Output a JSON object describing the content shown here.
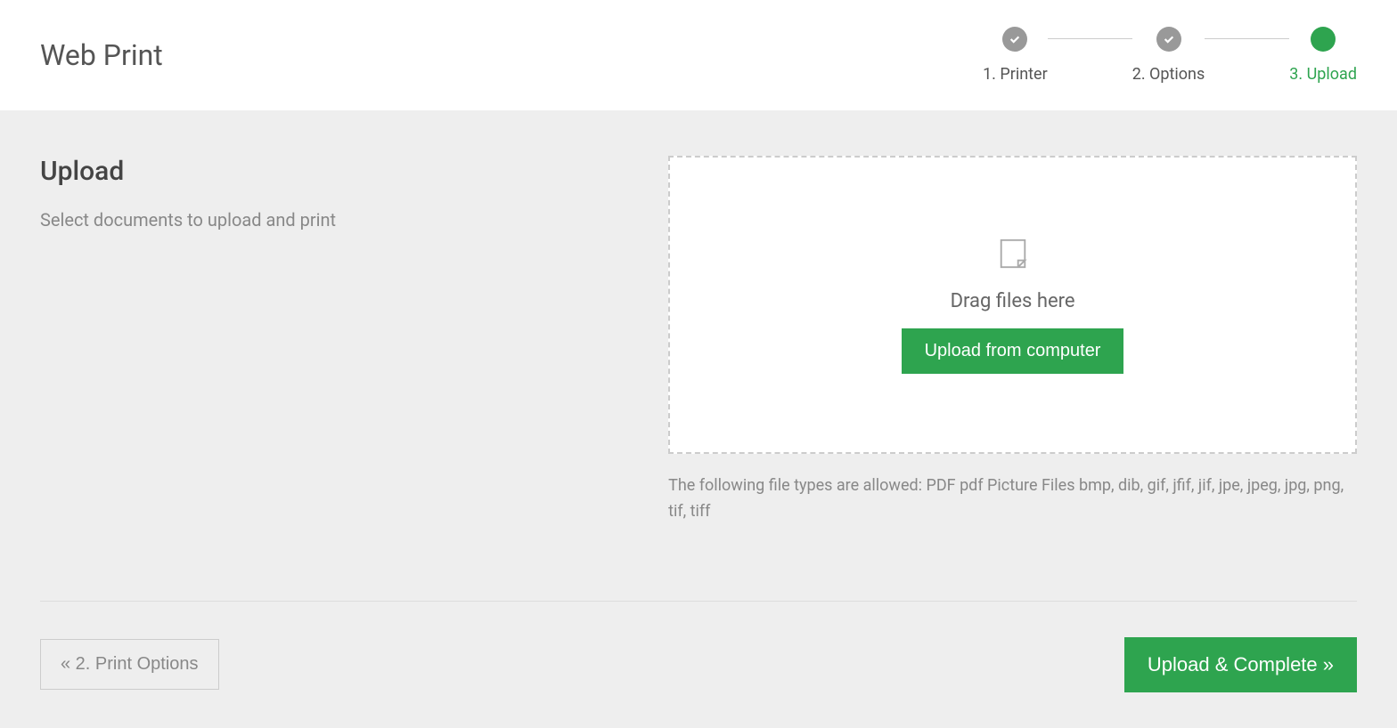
{
  "header": {
    "title": "Web Print"
  },
  "stepper": {
    "steps": [
      {
        "label": "1. Printer",
        "state": "completed"
      },
      {
        "label": "2. Options",
        "state": "completed"
      },
      {
        "label": "3. Upload",
        "state": "active"
      }
    ]
  },
  "upload": {
    "section_title": "Upload",
    "section_subtitle": "Select documents to upload and print",
    "drag_text": "Drag files here",
    "upload_button_label": "Upload from computer",
    "file_types_text": "The following file types are allowed: PDF pdf Picture Files bmp, dib, gif, jfif, jif, jpe, jpeg, jpg, png, tif, tiff"
  },
  "footer": {
    "back_label": "« 2. Print Options",
    "complete_label": "Upload & Complete »"
  }
}
